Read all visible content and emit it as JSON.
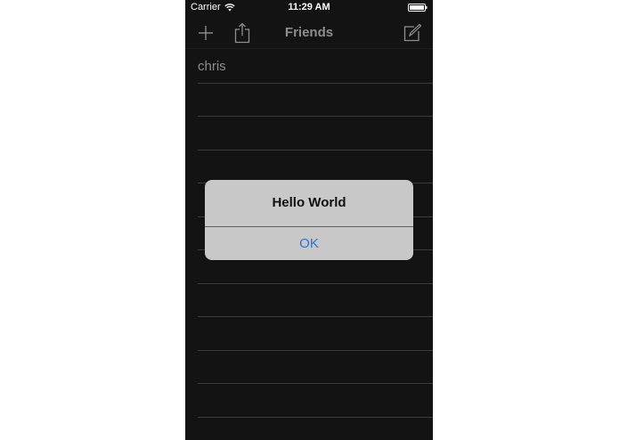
{
  "status_bar": {
    "carrier": "Carrier",
    "time": "11:29 AM",
    "icons": [
      "wifi-icon",
      "battery-icon"
    ]
  },
  "nav_bar": {
    "title": "Friends",
    "left_buttons": [
      "plus-icon",
      "share-icon"
    ],
    "right_buttons": [
      "compose-icon"
    ]
  },
  "friends_list": {
    "items": [
      "chris",
      "",
      "",
      "",
      "",
      "",
      "",
      "",
      "",
      "",
      "",
      ""
    ]
  },
  "alert": {
    "title": "Hello World",
    "button_label": "OK"
  },
  "colors": {
    "background": "#131313",
    "alert_background": "#c8c8c8",
    "alert_button": "#2b74e0",
    "nav_title": "#8e8e8e"
  }
}
